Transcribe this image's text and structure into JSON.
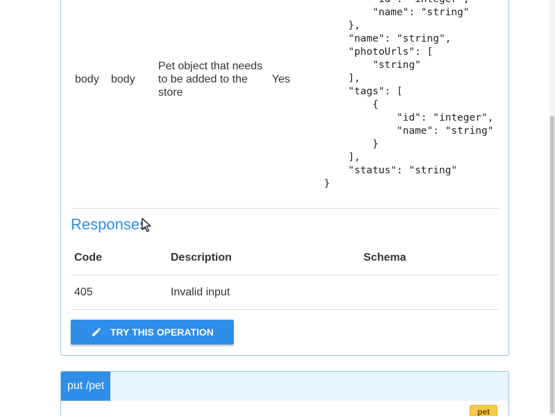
{
  "parameter": {
    "name": "body",
    "in": "body",
    "description": "Pet object that needs to be added to the store",
    "required": "Yes",
    "schema_example": "        \"id\": \"integer\",\n        \"name\": \"string\"\n    },\n    \"name\": \"string\",\n    \"photoUrls\": [\n        \"string\"\n    ],\n    \"tags\": [\n        {\n            \"id\": \"integer\",\n            \"name\": \"string\"\n        }\n    ],\n    \"status\": \"string\"\n}"
  },
  "responses": {
    "title": "Responses",
    "headers": {
      "code": "Code",
      "description": "Description",
      "schema": "Schema"
    },
    "rows": [
      {
        "code": "405",
        "description": "Invalid input",
        "schema": ""
      }
    ]
  },
  "actions": {
    "try_label": "TRY THIS OPERATION",
    "try_icon": "pencil-icon"
  },
  "next_operation": {
    "method_path": "put /pet",
    "tag": "pet"
  },
  "colors": {
    "accent": "#2e8ee8",
    "card_border": "#8fc3e8",
    "header_bg": "#e8f4fd",
    "tag_bg": "#f7c948"
  }
}
